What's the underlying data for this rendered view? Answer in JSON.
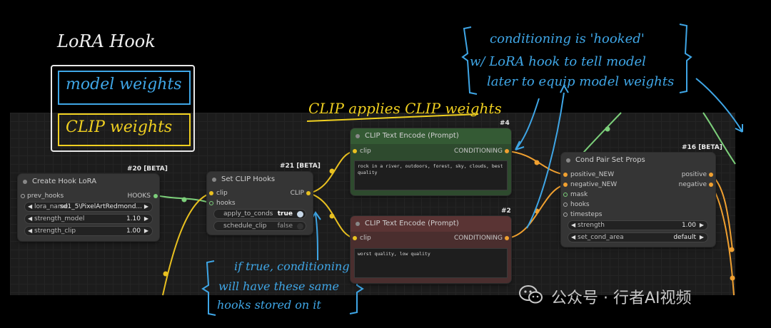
{
  "colors": {
    "accent_yellow": "#f0d020",
    "accent_blue": "#3fa6e6",
    "wire_green": "#7ccf7a",
    "wire_orange": "#f0a030"
  },
  "nodes": {
    "hook_lora": {
      "badge": "#20 [BETA]",
      "title": "Create Hook LoRA",
      "input_prev_hooks": "prev_hooks",
      "output_hooks": "HOOKS",
      "lora_name_label": "lora_name",
      "lora_name_value": "sd1_5\\PixelArtRedmond...",
      "strength_model_label": "strength_model",
      "strength_model_value": "1.10",
      "strength_clip_label": "strength_clip",
      "strength_clip_value": "1.00"
    },
    "set_clip_hooks": {
      "badge": "#21 [BETA]",
      "title": "Set CLIP Hooks",
      "input_clip": "clip",
      "input_hooks": "hooks",
      "output_clip": "CLIP",
      "apply_label": "apply_to_conds",
      "apply_value": "true",
      "schedule_label": "schedule_clip",
      "schedule_value": "false"
    },
    "clip_pos": {
      "badge": "#4",
      "title": "CLIP Text Encode (Prompt)",
      "input_clip": "clip",
      "output": "CONDITIONING",
      "text": "rock in a river, outdoors, forest, sky, clouds, best quality"
    },
    "clip_neg": {
      "badge": "#2",
      "title": "CLIP Text Encode (Prompt)",
      "input_clip": "clip",
      "output": "CONDITIONING",
      "text": "worst quality, low quality"
    },
    "cond_pair": {
      "badge": "#16 [BETA]",
      "title": "Cond Pair Set Props",
      "in_positive": "positive_NEW",
      "in_negative": "negative_NEW",
      "in_mask": "mask",
      "in_hooks": "hooks",
      "in_timesteps": "timesteps",
      "out_positive": "positive",
      "out_negative": "negative",
      "strength_label": "strength",
      "strength_value": "1.00",
      "set_cond_area_label": "set_cond_area",
      "set_cond_area_value": "default"
    }
  },
  "annotations": {
    "lora_hook": "LoRA Hook",
    "model_weights": "model weights",
    "clip_weights": "CLIP weights",
    "clip_applies": "CLIP applies CLIP weights",
    "conditioning_line1": "conditioning is 'hooked'",
    "conditioning_line2": "w/ LoRA hook to tell model",
    "conditioning_line3": "later to equip model weights",
    "iftrue_line1": "if true, conditioning",
    "iftrue_line2": "will have these same",
    "iftrue_line3": "hooks stored on it"
  },
  "watermark": {
    "text": "公众号 · 行者AI视频",
    "icon": "wechat-icon"
  }
}
